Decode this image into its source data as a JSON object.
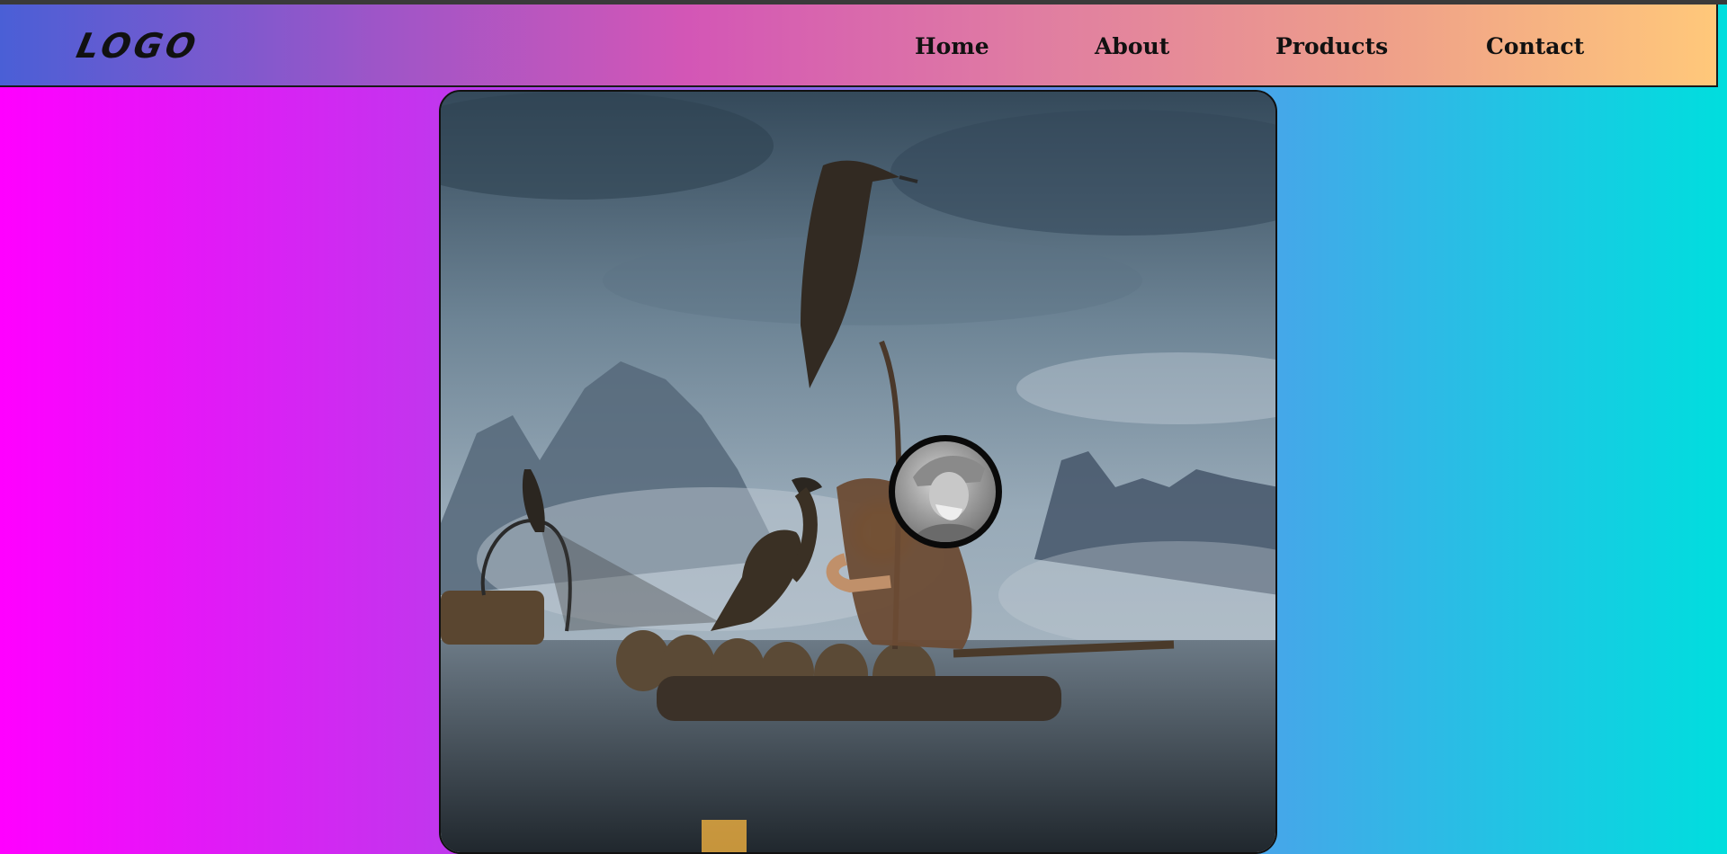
{
  "header": {
    "logo": "LOGO",
    "nav": [
      {
        "label": "Home"
      },
      {
        "label": "About"
      },
      {
        "label": "Products"
      },
      {
        "label": "Contact"
      }
    ]
  },
  "main": {
    "image": {
      "icon": "cormorant-fisherman-photo"
    },
    "avatar": {
      "icon": "fisherman-portrait-avatar"
    }
  },
  "colors": {
    "page_gradient": [
      "#ff00ff",
      "#00dede"
    ],
    "header_gradient": [
      "#4a5fd6",
      "#ffc87a"
    ],
    "text": "#111111"
  }
}
